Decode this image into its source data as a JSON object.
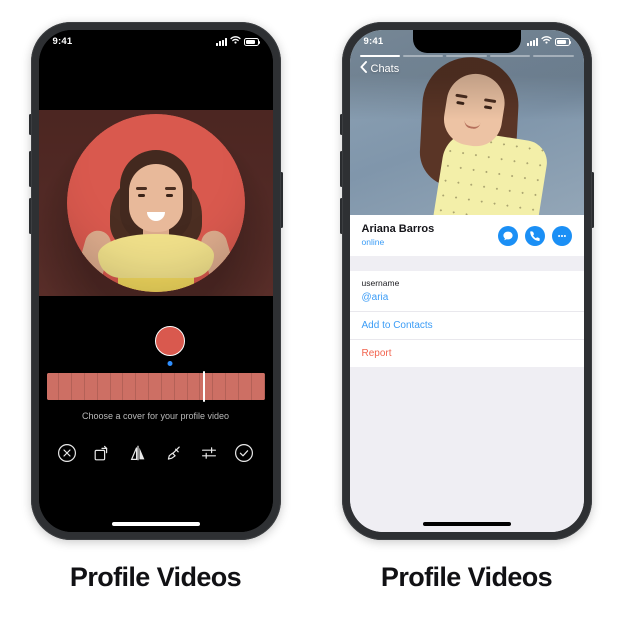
{
  "left": {
    "caption": "Profile Videos",
    "status_bar": {
      "time": "9:41",
      "signal_icon": "signal-bars-icon",
      "wifi_icon": "wifi-icon",
      "battery_icon": "battery-icon"
    },
    "hint": "Choose a cover for your profile video",
    "scrubber_position_percent": 72,
    "filmstrip_frame_count": 17,
    "avatar_preview_name": "cover-avatar-preview",
    "toolbar": [
      {
        "name": "cancel-button",
        "icon": "circle-x-icon",
        "label": "Cancel"
      },
      {
        "name": "rotate-button",
        "icon": "rotate-icon",
        "label": "Rotate"
      },
      {
        "name": "flip-button",
        "icon": "mirror-flip-icon",
        "label": "Flip"
      },
      {
        "name": "draw-button",
        "icon": "brush-icon",
        "label": "Draw"
      },
      {
        "name": "adjust-button",
        "icon": "sliders-icon",
        "label": "Adjust"
      },
      {
        "name": "confirm-button",
        "icon": "circle-check-icon",
        "label": "Done"
      }
    ]
  },
  "right": {
    "caption": "Profile Videos",
    "status_bar": {
      "time": "9:41",
      "signal_icon": "signal-bars-icon",
      "wifi_icon": "wifi-icon",
      "battery_icon": "battery-icon"
    },
    "back_label": "Chats",
    "media_segments": 5,
    "media_active_index": 0,
    "profile": {
      "name": "Ariana Barros",
      "status": "online",
      "status_color": "#3b9cf6",
      "actions": [
        {
          "name": "message-button",
          "icon": "chat-bubble-icon"
        },
        {
          "name": "call-button",
          "icon": "phone-icon"
        },
        {
          "name": "more-button",
          "icon": "ellipsis-icon"
        }
      ]
    },
    "info_rows": [
      {
        "label": "username",
        "value": "@aria"
      }
    ],
    "add_to_contacts_label": "Add to Contacts",
    "report_label": "Report",
    "report_color": "#f2644f",
    "accent_color": "#1b8ff5"
  }
}
